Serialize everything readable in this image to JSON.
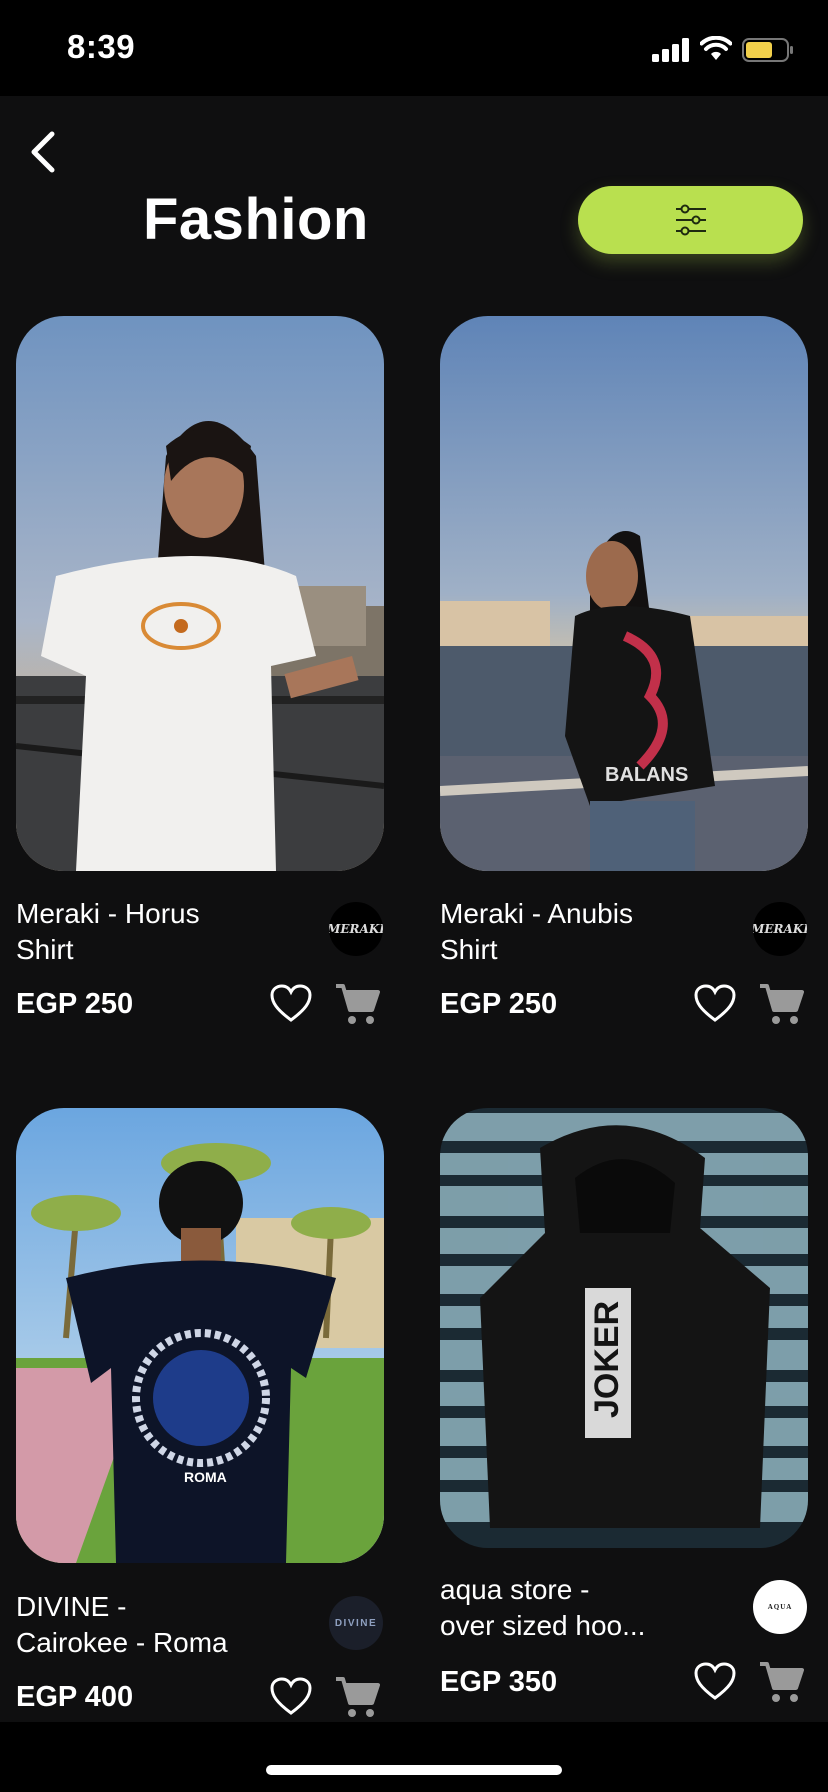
{
  "status_bar": {
    "time": "8:39",
    "battery_color": "#f2d04b"
  },
  "header": {
    "back_icon": "chevron-left-icon",
    "title": "Fashion",
    "filter_icon": "sliders-icon",
    "filter_button_color": "#b9e04f"
  },
  "products": [
    {
      "name_line1": "Meraki - Horus",
      "name_line2": "Shirt",
      "price": "EGP 250",
      "brand_logo_text": "MERAKI"
    },
    {
      "name_line1": "Meraki - Anubis",
      "name_line2": "Shirt",
      "price": "EGP 250",
      "brand_logo_text": "MERAKI"
    },
    {
      "name_line1": "DIVINE -",
      "name_line2": "Cairokee - Roma",
      "price": "EGP 400",
      "brand_logo_text": "DIVINE"
    },
    {
      "name_line1": "aqua store -",
      "name_line2": "over sized hoo...",
      "price": "EGP 350",
      "brand_logo_text": "AQUA"
    }
  ],
  "product_image_texts": {
    "shirt2_print": "BALANS",
    "shirt3_print": "ROMA",
    "hoodie_print": "JOKER"
  }
}
